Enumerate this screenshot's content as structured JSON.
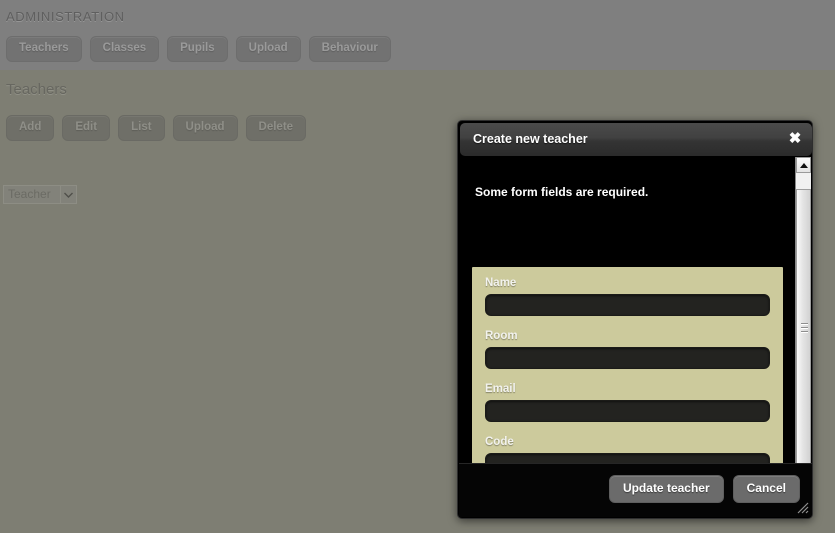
{
  "page": {
    "admin_heading": "ADMINISTRATION",
    "section_heading": "Teachers",
    "nav_tabs": [
      {
        "label": "Teachers"
      },
      {
        "label": "Classes"
      },
      {
        "label": "Pupils"
      },
      {
        "label": "Upload"
      },
      {
        "label": "Behaviour"
      }
    ],
    "action_buttons": [
      {
        "label": "Add"
      },
      {
        "label": "Edit"
      },
      {
        "label": "List"
      },
      {
        "label": "Upload"
      },
      {
        "label": "Delete"
      }
    ],
    "teacher_select": {
      "selected": "Teacher",
      "options": [
        "Teacher"
      ],
      "arrow_icon": "chevron-down-icon"
    }
  },
  "dialog": {
    "title": "Create new teacher",
    "close_icon": "close-icon",
    "close_glyph": "✖",
    "required_note": "Some form fields are required.",
    "fields": [
      {
        "label": "Name",
        "value": "",
        "placeholder": ""
      },
      {
        "label": "Room",
        "value": "",
        "placeholder": ""
      },
      {
        "label": "Email",
        "value": "",
        "placeholder": ""
      },
      {
        "label": "Code",
        "value": "",
        "placeholder": ""
      }
    ],
    "submit_label": "Update teacher",
    "cancel_label": "Cancel",
    "scrollbar": {
      "up_icon": "scroll-up-arrow-icon",
      "down_icon": "scroll-down-arrow-icon",
      "grip_icon": "scrollbar-grip-icon"
    },
    "resize_icon": "resize-grip-icon"
  },
  "colors": {
    "page_background": "#7e7e73",
    "page_background_top": "#7f7f7f",
    "dialog_background": "#000000",
    "titlebar": "#3d3d3d",
    "form_panel": "#ccca9c",
    "input_background": "#232320",
    "button_gray": "#6b6b6b",
    "scrollbar": "#e6e6e6"
  }
}
